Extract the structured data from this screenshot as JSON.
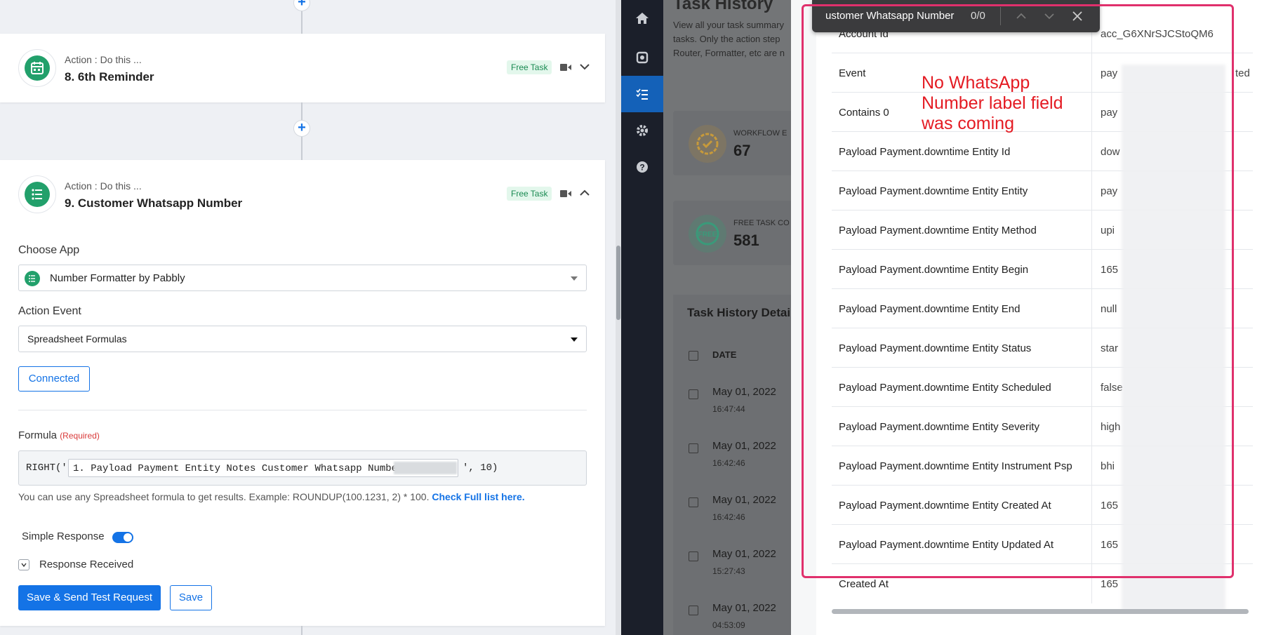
{
  "workflow": {
    "steps": [
      {
        "sub": "Action : Do this ...",
        "title": "8. 6th Reminder",
        "badge": "Free Task",
        "expanded": false
      },
      {
        "sub": "Action : Do this ...",
        "title": "9. Customer Whatsapp Number",
        "badge": "Free Task",
        "expanded": true
      }
    ],
    "form": {
      "choose_app_label": "Choose App",
      "app_value": "Number Formatter by Pabbly",
      "action_event_label": "Action Event",
      "action_event_value": "Spreadsheet Formulas",
      "connected_label": "Connected",
      "formula_label": "Formula",
      "required_label": "(Required)",
      "formula_prefix": "RIGHT('",
      "formula_chip": "1. Payload Payment Entity Notes Customer Whatsapp Number : 6",
      "formula_suffix": "', 10)",
      "hint_text": "You can use any Spreadsheet formula to get results. Example: ROUNDUP(100.1231, 2) * 100.",
      "hint_link": "Check Full list here.",
      "simple_response_label": "Simple Response",
      "simple_response_on": true,
      "response_received_label": "Response Received",
      "save_send_label": "Save & Send Test Request",
      "save_label": "Save"
    }
  },
  "sidebar": {
    "items": [
      {
        "icon": "home-icon",
        "active": false
      },
      {
        "icon": "integrations-icon",
        "active": false
      },
      {
        "icon": "task-list-icon",
        "active": true
      },
      {
        "icon": "gear-icon",
        "active": false
      },
      {
        "icon": "help-icon",
        "active": false
      }
    ]
  },
  "history": {
    "title": "Task History",
    "desc_lines": [
      "View all your task summary",
      "tasks. Only the action step",
      "Router, Formatter, etc are n"
    ],
    "cards": [
      {
        "label": "WORKFLOW E",
        "value": "67",
        "color": "#c79a3b"
      },
      {
        "label": "FREE TASK CO",
        "value": "581",
        "color": "#3a9a7a"
      }
    ],
    "table_title": "Task History Detai",
    "date_col": "DATE",
    "rows": [
      {
        "date": "May 01, 2022",
        "time": "16:47:44"
      },
      {
        "date": "May 01, 2022",
        "time": "16:42:46"
      },
      {
        "date": "May 01, 2022",
        "time": "16:42:46"
      },
      {
        "date": "May 01, 2022",
        "time": "15:27:43"
      },
      {
        "date": "May 01, 2022",
        "time": "04:53:09"
      }
    ]
  },
  "data_panel": {
    "rows": [
      {
        "key": "Account Id",
        "value": "acc_G6XNrSJCStoQM6"
      },
      {
        "key": "Event",
        "value": "pay"
      },
      {
        "key": "Contains 0",
        "value": "pay"
      },
      {
        "key": "Payload Payment.downtime Entity Id",
        "value": "dow"
      },
      {
        "key": "Payload Payment.downtime Entity Entity",
        "value": "pay"
      },
      {
        "key": "Payload Payment.downtime Entity Method",
        "value": "upi"
      },
      {
        "key": "Payload Payment.downtime Entity Begin",
        "value": "165"
      },
      {
        "key": "Payload Payment.downtime Entity End",
        "value": "null"
      },
      {
        "key": "Payload Payment.downtime Entity Status",
        "value": "star"
      },
      {
        "key": "Payload Payment.downtime Entity Scheduled",
        "value": "false"
      },
      {
        "key": "Payload Payment.downtime Entity Severity",
        "value": "high"
      },
      {
        "key": "Payload Payment.downtime Entity Instrument Psp",
        "value": "bhi"
      },
      {
        "key": "Payload Payment.downtime Entity Created At",
        "value": "165"
      },
      {
        "key": "Payload Payment.downtime Entity Updated At",
        "value": "165"
      },
      {
        "key": "Created At",
        "value": "165"
      }
    ],
    "event_tail": "ted"
  },
  "find_bar": {
    "query": "ustomer Whatsapp Number",
    "count": "0/0"
  },
  "annotation": {
    "text": "No WhatsApp Number label field was coming",
    "color": "#e41b23",
    "box_color": "#e0306c"
  }
}
